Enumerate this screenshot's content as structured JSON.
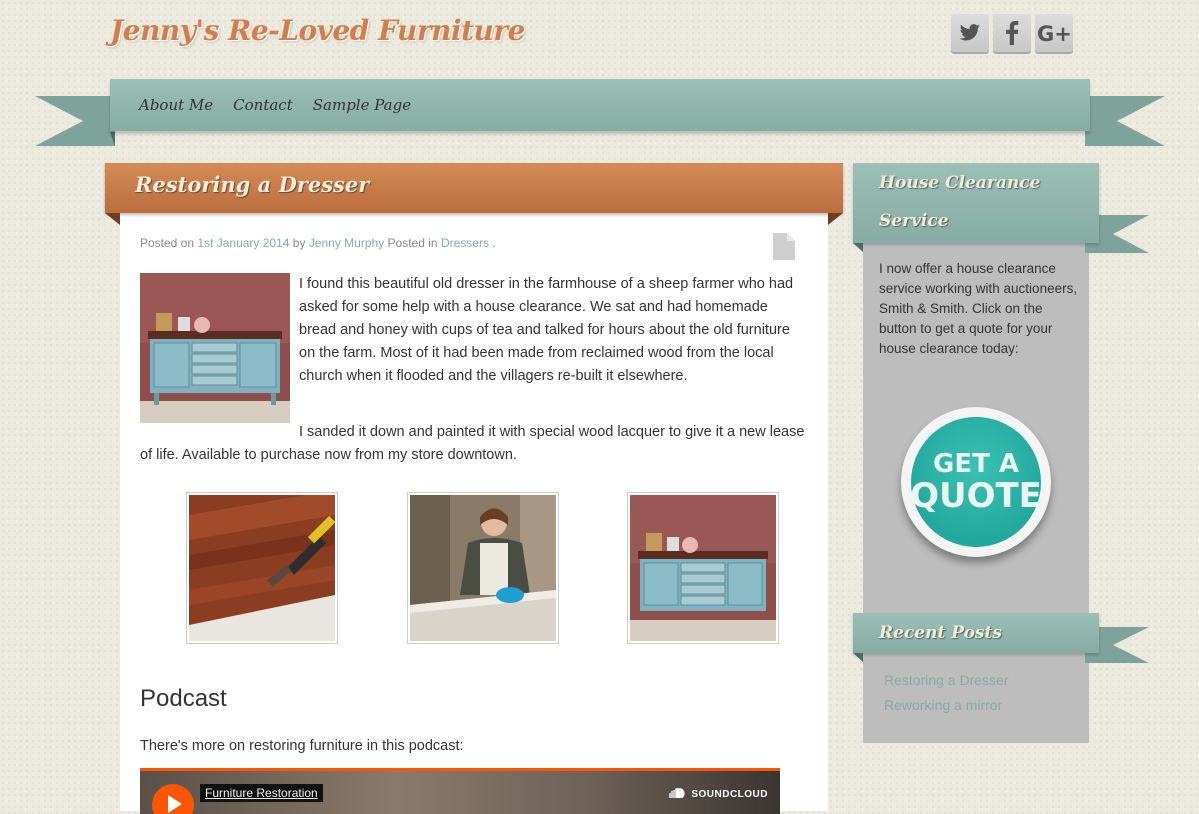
{
  "site": {
    "title": "Jenny's Re-Loved Furniture"
  },
  "social": [
    {
      "name": "twitter-icon",
      "glyph": "🐦"
    },
    {
      "name": "facebook-icon",
      "glyph": "f"
    },
    {
      "name": "google-plus-icon",
      "glyph": "G+"
    }
  ],
  "nav": {
    "items": [
      "About Me",
      "Contact",
      "Sample Page"
    ]
  },
  "post": {
    "title": "Restoring a Dresser",
    "meta": {
      "posted_on": "Posted on",
      "date": "1st January 2014",
      "by": "by",
      "author": "Jenny Murphy",
      "posted_in": "Posted in",
      "category": "Dressers",
      "trailing": " ."
    },
    "paragraph1": "I found this beautiful old dresser in the farmhouse of a sheep farmer who had asked for some help with a house clearance. We sat and had homemade bread and honey with cups of tea and talked for hours about the old furniture on the farm. Most of it had been made from reclaimed wood from the local church when it flooded and the villagers re-built it elsewhere.",
    "paragraph2": "I sanded it down and painted it with special wood lacquer to give it a new lease of life. Available to purchase now from my store downtown.",
    "podcast_heading": "Podcast",
    "podcast_intro": "There's more on restoring furniture in this podcast:",
    "player": {
      "track_title": "Furniture Restoration",
      "brand": "SOUNDCLOUD"
    }
  },
  "sidebar": {
    "clearance": {
      "title_line1": "House Clearance",
      "title_line2": "Service",
      "text": "I now offer a house clearance service working with auctioneers, Smith & Smith. Click on the button to get a quote for your house clearance today:",
      "button_line1": "GET A",
      "button_line2": "QUOTE"
    },
    "recent": {
      "title": "Recent Posts",
      "items": [
        "Restoring a Dresser",
        "Reworking a mirror"
      ]
    }
  },
  "colors": {
    "accent_orange": "#c97a45",
    "ribbon_teal": "#8fb3aa",
    "quote_teal": "#26aa9e",
    "soundcloud_orange": "#ff5500"
  }
}
